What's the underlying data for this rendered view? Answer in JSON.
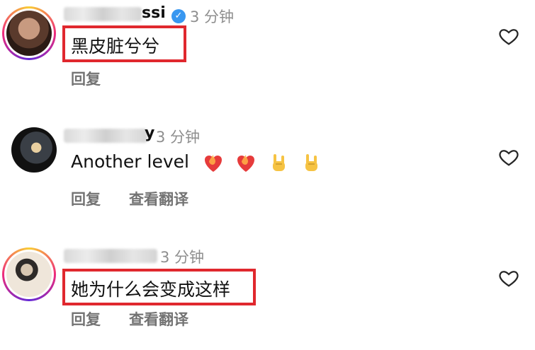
{
  "comments": [
    {
      "user_suffix": "ssi",
      "verified": true,
      "time": "3 分钟",
      "text": "黑皮脏兮兮",
      "reply": "回复",
      "translate": ""
    },
    {
      "user_suffix": "y",
      "verified": false,
      "time": "3 分钟",
      "text": "Another level",
      "emojis": [
        "heart-on-fire-emoji",
        "heart-on-fire-emoji",
        "sign-of-the-horns-emoji",
        "sign-of-the-horns-emoji"
      ],
      "reply": "回复",
      "translate": "查看翻译"
    },
    {
      "user_suffix": "",
      "verified": false,
      "time": "3 分钟",
      "text": "她为什么会变成这样",
      "reply": "回复",
      "translate": "查看翻译"
    }
  ],
  "colors": {
    "highlight": "#e0282e",
    "muted": "#8e8e8e",
    "verified": "#3897f0"
  }
}
